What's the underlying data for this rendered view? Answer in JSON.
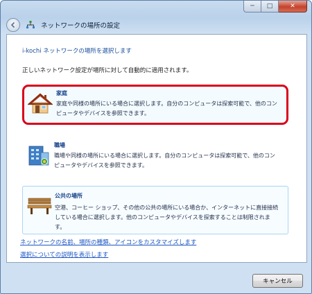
{
  "window": {
    "title": "ネットワークの場所の設定",
    "caption_buttons": {
      "minimize": "─",
      "maximize": "□",
      "close": "✕"
    }
  },
  "heading": "i-kochi ネットワークの場所を選択します",
  "subheading": "正しいネットワーク設定が場所に対して自動的に適用されます。",
  "options": [
    {
      "title": "家庭",
      "description": "家庭や同様の場所にいる場合に選択します。自分のコンピュータは探索可能で、他のコンピュータやデバイスを参照できます。",
      "icon": "house-icon"
    },
    {
      "title": "職場",
      "description": "職場や同様の場所にいる場合に選択します。自分のコンピュータは探索可能で、他のコンピュータやデバイスを参照できます。",
      "icon": "office-building-icon"
    },
    {
      "title": "公共の場所",
      "description": "空港、コーヒー ショップ、その他の公共の場所にいる場合か、インターネットに直接接続している場合に選択します。他のコンピュータやデバイスを探索することは制限されます。",
      "icon": "park-bench-icon"
    }
  ],
  "links": {
    "customize": "ネットワークの名前、場所の種類、アイコンをカスタマイズします",
    "explain": "選択についての説明を表示します"
  },
  "cancel_label": "キャンセル",
  "colors": {
    "heading": "#1a4e9a",
    "link": "#1a55c4",
    "highlight_border": "#d9001a",
    "title_bar": "#b9d1ea"
  }
}
